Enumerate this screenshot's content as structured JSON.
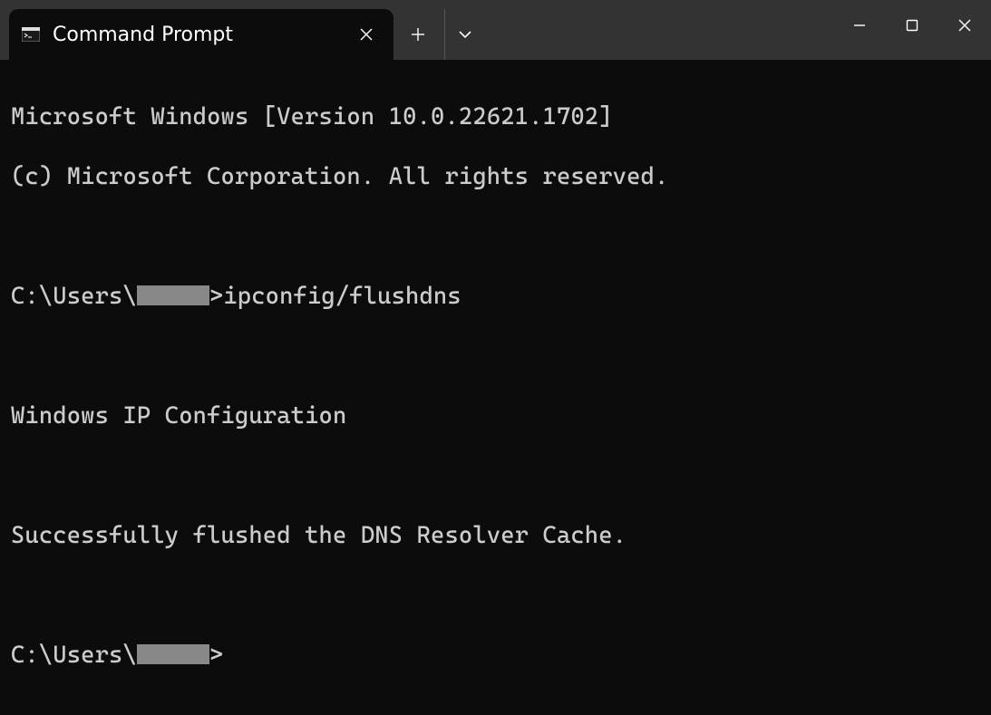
{
  "tab": {
    "title": "Command Prompt"
  },
  "terminal": {
    "header_line1": "Microsoft Windows [Version 10.0.22621.1702]",
    "header_line2": "(c) Microsoft Corporation. All rights reserved.",
    "prompt1_prefix": "C:\\Users\\",
    "prompt1_suffix": ">",
    "command1": "ipconfig/flushdns",
    "output_line1": "Windows IP Configuration",
    "output_line2": "Successfully flushed the DNS Resolver Cache.",
    "prompt2_prefix": "C:\\Users\\",
    "prompt2_suffix": ">"
  }
}
